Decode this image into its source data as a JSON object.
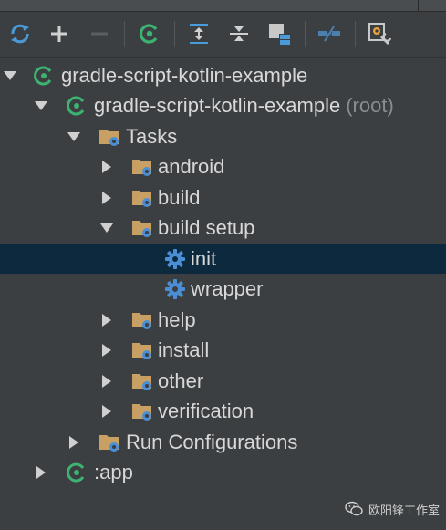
{
  "toolbar": {
    "buttons": [
      {
        "name": "refresh-all-projects-button",
        "icon": "refresh-icon"
      },
      {
        "name": "attach-gradle-project-button",
        "icon": "plus-icon"
      },
      {
        "name": "detach-gradle-project-button",
        "icon": "minus-icon"
      },
      {
        "name": "execute-gradle-task-button",
        "icon": "gradle-icon"
      },
      {
        "name": "expand-all-button",
        "icon": "expand-all-icon"
      },
      {
        "name": "collapse-all-button",
        "icon": "collapse-all-icon"
      },
      {
        "name": "group-modules-button",
        "icon": "group-modules-icon"
      },
      {
        "name": "toggle-offline-mode-button",
        "icon": "offline-mode-icon"
      },
      {
        "name": "gradle-settings-button",
        "icon": "settings-wrench-icon"
      }
    ]
  },
  "tree": {
    "root": {
      "label": "gradle-script-kotlin-example"
    },
    "module": {
      "label": "gradle-script-kotlin-example",
      "suffix": "(root)"
    },
    "tasks": {
      "label": "Tasks"
    },
    "android": {
      "label": "android"
    },
    "build": {
      "label": "build"
    },
    "build_setup": {
      "label": "build setup"
    },
    "init": {
      "label": "init"
    },
    "wrapper": {
      "label": "wrapper"
    },
    "help": {
      "label": "help"
    },
    "install": {
      "label": "install"
    },
    "other": {
      "label": "other"
    },
    "verification": {
      "label": "verification"
    },
    "run_configurations": {
      "label": "Run Configurations"
    },
    "app": {
      "label": ":app"
    }
  },
  "watermark": {
    "text": "欧阳锋工作室",
    "icon": "wechat-icon"
  },
  "colors": {
    "background": "#3c3f41",
    "selection": "#0d293e",
    "text": "#d8d8d8",
    "muted": "#8a8d90",
    "gradle_green": "#3cb371",
    "folder": "#c9a064",
    "gear_blue": "#4a8fd6"
  }
}
